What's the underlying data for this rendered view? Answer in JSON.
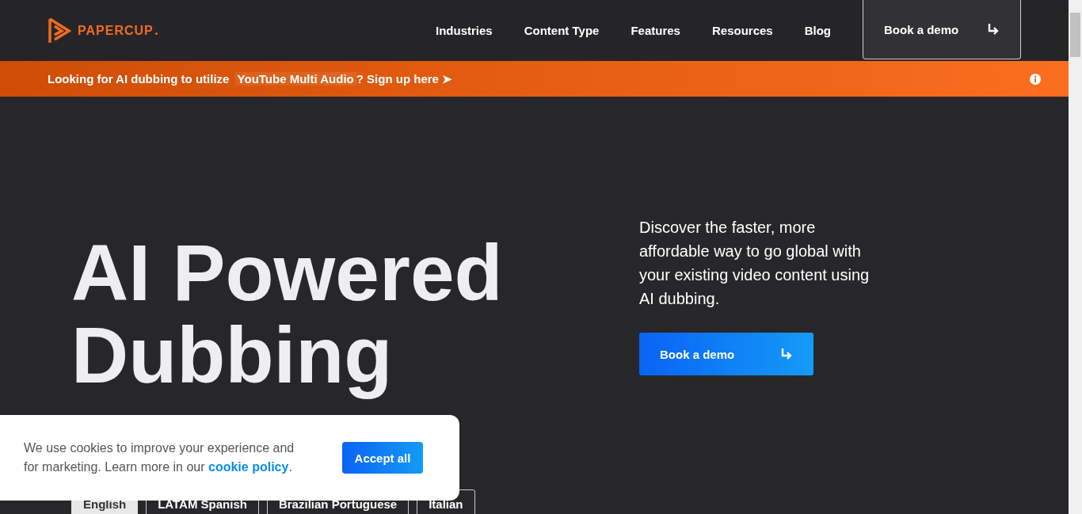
{
  "logo": {
    "text": "PAPERCUP"
  },
  "nav": {
    "items": [
      "Industries",
      "Content Type",
      "Features",
      "Resources",
      "Blog"
    ],
    "cta": "Book a demo"
  },
  "announcement": {
    "prefix": "Looking for AI dubbing to utilize",
    "link": "YouTube Multi Audio",
    "suffix": "? Sign up here ➤"
  },
  "hero": {
    "title_lines": [
      "AI Powered",
      "Dubbing"
    ],
    "description": "Discover the faster, more affordable way to go global with your existing video content using AI dubbing.",
    "cta": "Book a demo"
  },
  "language_tabs": [
    {
      "label": "English",
      "selected": true
    },
    {
      "label": "LATAM Spanish",
      "selected": false
    },
    {
      "label": "Brazilian Portuguese",
      "selected": false
    },
    {
      "label": "Italian",
      "selected": false
    }
  ],
  "cookie_banner": {
    "text": "We use cookies to improve your experience and for marketing. Learn more in our",
    "link": "cookie policy",
    "after": ".",
    "button": "Accept all"
  }
}
